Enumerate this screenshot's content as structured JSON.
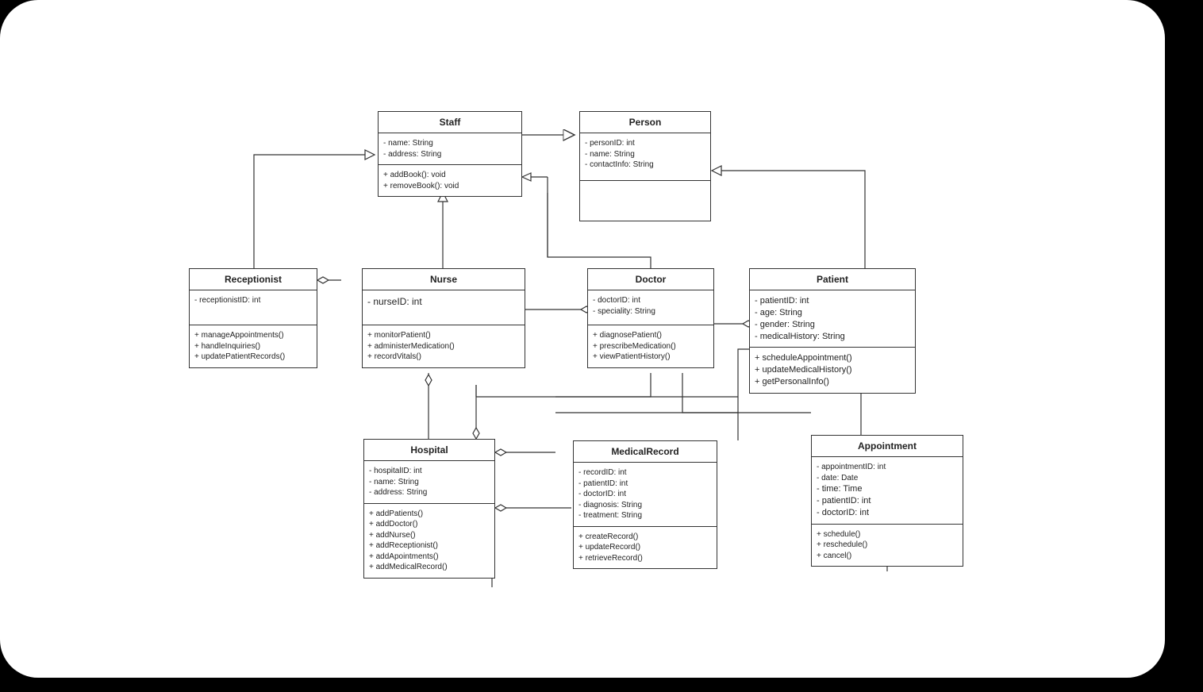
{
  "classes": {
    "staff": {
      "title": "Staff",
      "attrs": [
        "- name: String",
        "- address: String"
      ],
      "methods": [
        "+ addBook(): void",
        "+ removeBook(): void"
      ]
    },
    "person": {
      "title": "Person",
      "attrs": [
        "- personID: int",
        "- name: String",
        "- contactInfo: String"
      ],
      "methods": []
    },
    "receptionist": {
      "title": "Receptionist",
      "attrs": [
        "- receptionistID: int"
      ],
      "methods": [
        "+ manageAppointments()",
        "+ handleInquiries()",
        "+ updatePatientRecords()"
      ]
    },
    "nurse": {
      "title": "Nurse",
      "attrs": [
        "- nurseID: int"
      ],
      "methods": [
        "+ monitorPatient()",
        "+ administerMedication()",
        "+ recordVitals()"
      ]
    },
    "doctor": {
      "title": "Doctor",
      "attrs": [
        "- doctorID: int",
        "- speciality: String"
      ],
      "methods": [
        "+ diagnosePatient()",
        "+ prescribeMedication()",
        "+ viewPatientHistory()"
      ]
    },
    "patient": {
      "title": "Patient",
      "attrs": [
        "- patientID: int",
        "- age: String",
        "- gender: String",
        "- medicalHistory: String"
      ],
      "methods": [
        "+ scheduleAppointment()",
        "+ updateMedicalHistory()",
        "+ getPersonalInfo()"
      ]
    },
    "hospital": {
      "title": "Hospital",
      "attrs": [
        "- hospitalID: int",
        "- name: String",
        "- address: String"
      ],
      "methods": [
        "+ addPatients()",
        "+ addDoctor()",
        "+ addNurse()",
        "+ addReceptionist()",
        "+ addApointments()",
        "+ addMedicalRecord()"
      ]
    },
    "medicalrecord": {
      "title": "MedicalRecord",
      "attrs": [
        "- recordID: int",
        "- patientID: int",
        "- doctorID: int",
        "- diagnosis: String",
        "- treatment: String"
      ],
      "methods": [
        "+ createRecord()",
        "+ updateRecord()",
        "+ retrieveRecord()"
      ]
    },
    "appointment": {
      "title": "Appointment",
      "attrs": [
        "- appointmentID: int",
        "- date: Date",
        "- time: Time",
        "- patientID: int",
        "- doctorID: int"
      ],
      "methods": [
        "+ schedule()",
        "+ reschedule()",
        "+ cancel()"
      ]
    }
  }
}
